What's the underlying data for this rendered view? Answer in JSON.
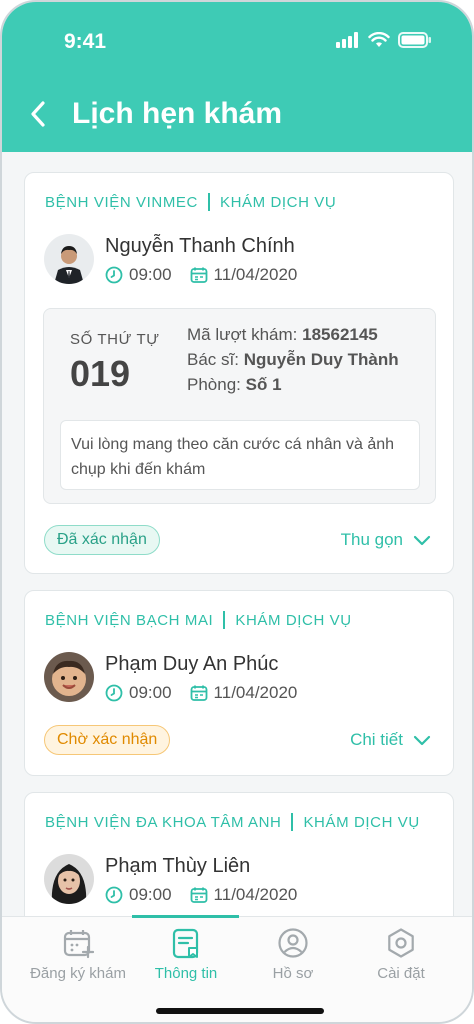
{
  "status_bar": {
    "time": "9:41"
  },
  "header": {
    "title": "Lịch hẹn khám"
  },
  "appointments": [
    {
      "hospital": "BỆNH VIỆN VINMEC",
      "service": "KHÁM DỊCH VỤ",
      "patient": "Nguyễn Thanh Chính",
      "time": "09:00",
      "date": "11/04/2020",
      "order_label": "SỐ THỨ TỰ",
      "order_number": "019",
      "visit_code_label": "Mã lượt khám:",
      "visit_code": "18562145",
      "doctor_label": "Bác sĩ:",
      "doctor": "Nguyễn Duy Thành",
      "room_label": "Phòng:",
      "room": "Số 1",
      "note": "Vui lòng mang theo căn cước cá nhân và ảnh chụp khi đến khám",
      "status": "Đã xác nhận",
      "toggle_label": "Thu gọn"
    },
    {
      "hospital": "BỆNH VIỆN BẠCH MAI",
      "service": "KHÁM DỊCH VỤ",
      "patient": "Phạm Duy An Phúc",
      "time": "09:00",
      "date": "11/04/2020",
      "status": "Chờ xác nhận",
      "toggle_label": "Chi tiết"
    },
    {
      "hospital": "BỆNH VIỆN ĐA KHOA TÂM ANH",
      "service": "KHÁM DỊCH VỤ",
      "patient": "Phạm Thùy Liên",
      "time": "09:00",
      "date": "11/04/2020"
    }
  ],
  "tabs": [
    {
      "label": "Đăng ký khám",
      "icon": "calendar-add-icon"
    },
    {
      "label": "Thông tin",
      "icon": "document-icon",
      "active": true
    },
    {
      "label": "Hồ sơ",
      "icon": "profile-icon"
    },
    {
      "label": "Cài đặt",
      "icon": "settings-icon"
    }
  ],
  "colors": {
    "primary": "#3ecbb5",
    "confirmed": "#2aa188",
    "pending": "#e08a00"
  }
}
